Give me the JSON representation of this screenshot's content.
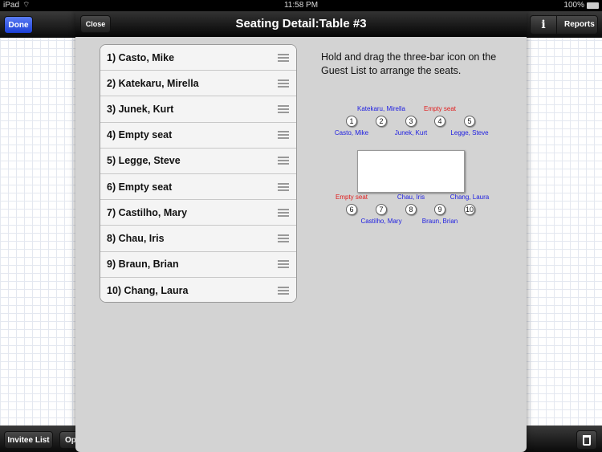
{
  "status": {
    "device": "iPad",
    "time": "11:58 PM",
    "battery": "100%"
  },
  "navbar": {
    "done": "Done",
    "reports": "Reports",
    "info": "i"
  },
  "toolbar": {
    "invitee_list": "Invitee List",
    "op": "Op"
  },
  "modal": {
    "title": "Seating Detail:Table #3",
    "close": "Close",
    "instructions": "Hold and drag the three-bar icon on the Guest List to arrange the seats.",
    "guests": [
      "1) Casto, Mike",
      "2) Katekaru, Mirella",
      "3) Junek, Kurt",
      "4) Empty seat",
      "5) Legge, Steve",
      "6) Empty seat",
      "7) Castilho, Mary",
      "8) Chau, Iris",
      "9) Braun, Brian",
      "10) Chang, Laura"
    ],
    "seats": [
      {
        "n": "1",
        "name": "Casto, Mike",
        "empty": false
      },
      {
        "n": "2",
        "name": "Katekaru, Mirella",
        "empty": false
      },
      {
        "n": "3",
        "name": "Junek, Kurt",
        "empty": false
      },
      {
        "n": "4",
        "name": "Empty seat",
        "empty": true
      },
      {
        "n": "5",
        "name": "Legge, Steve",
        "empty": false
      },
      {
        "n": "6",
        "name": "Empty seat",
        "empty": true
      },
      {
        "n": "7",
        "name": "Castilho, Mary",
        "empty": false
      },
      {
        "n": "8",
        "name": "Chau, Iris",
        "empty": false
      },
      {
        "n": "9",
        "name": "Braun, Brian",
        "empty": false
      },
      {
        "n": "10",
        "name": "Chang, Laura",
        "empty": false
      }
    ]
  },
  "colors": {
    "guest": "#2020e0",
    "empty": "#e02020",
    "done": "#2a4fe0"
  }
}
